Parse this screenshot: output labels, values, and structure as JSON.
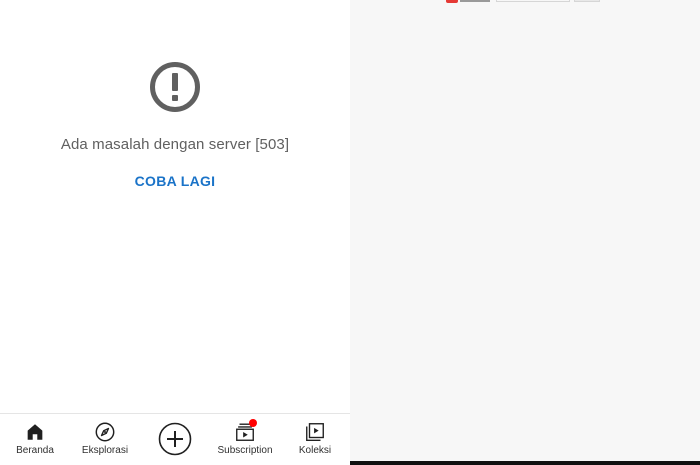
{
  "error": {
    "icon": "exclamation-circle-icon",
    "message": "Ada masalah dengan server [503]",
    "retry_label": "COBA LAGI"
  },
  "bottom_nav": {
    "items": [
      {
        "label": "Beranda",
        "icon": "home-icon"
      },
      {
        "label": "Eksplorasi",
        "icon": "compass-icon"
      },
      {
        "label": "",
        "icon": "add-circle-icon"
      },
      {
        "label": "Subscription",
        "icon": "subscriptions-icon"
      },
      {
        "label": "Koleksi",
        "icon": "library-icon"
      }
    ]
  },
  "colors": {
    "accent": "#1a73c8",
    "icon_gray": "#606060",
    "notification": "#ff0000",
    "right_background": "#f7f7f7"
  }
}
